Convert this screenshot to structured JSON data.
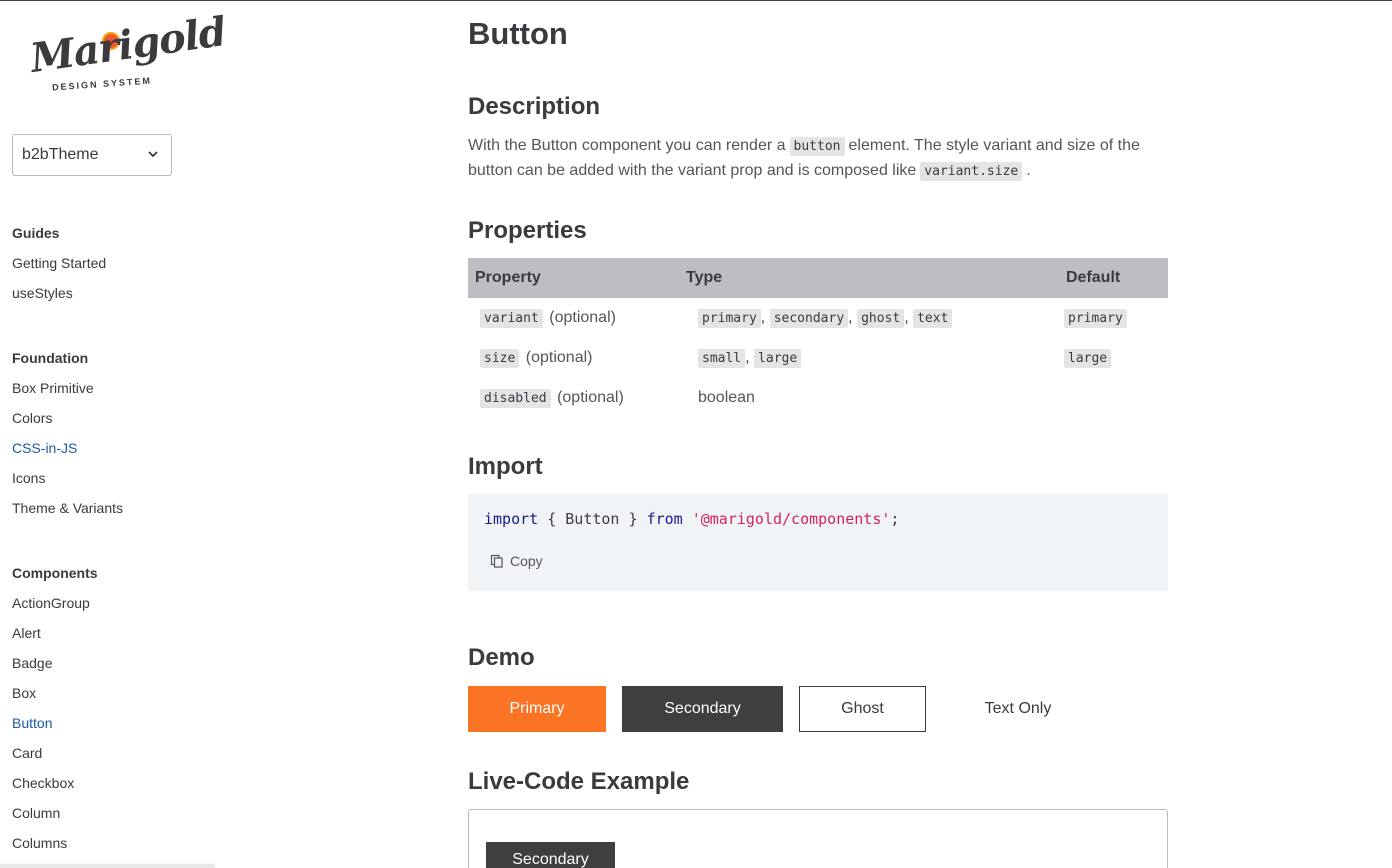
{
  "logo": {
    "script": "Marigold",
    "subtitle": "DESIGN SYSTEM"
  },
  "theme_select": {
    "value": "b2bTheme"
  },
  "sidebar": {
    "guides": {
      "title": "Guides",
      "items": [
        "Getting Started",
        "useStyles"
      ]
    },
    "foundation": {
      "title": "Foundation",
      "items": [
        "Box Primitive",
        "Colors",
        "CSS-in-JS",
        "Icons",
        "Theme & Variants"
      ]
    },
    "components": {
      "title": "Components",
      "items": [
        "ActionGroup",
        "Alert",
        "Badge",
        "Box",
        "Button",
        "Card",
        "Checkbox",
        "Column",
        "Columns"
      ]
    }
  },
  "page": {
    "title": "Button",
    "description_heading": "Description",
    "description": {
      "part1": "With the Button component you can render a",
      "code1": "button",
      "part2": "element. The style variant and size of the button can be added with the variant prop and is composed like",
      "code2": "variant.size",
      "part3": "."
    },
    "properties_heading": "Properties",
    "table": {
      "headers": [
        "Property",
        "Type",
        "Default"
      ],
      "rows": [
        {
          "property": "variant",
          "optional": "(optional)",
          "types": [
            "primary",
            "secondary",
            "ghost",
            "text"
          ],
          "default": "primary"
        },
        {
          "property": "size",
          "optional": "(optional)",
          "types": [
            "small",
            "large"
          ],
          "default": "large"
        },
        {
          "property": "disabled",
          "optional": "(optional)",
          "type_text": "boolean",
          "default": ""
        }
      ]
    },
    "import_heading": "Import",
    "import_code": {
      "kw_import": "import",
      "braces": " { Button } ",
      "kw_from": "from",
      "module": "'@marigold/components'",
      "semi": ";"
    },
    "copy_label": "Copy",
    "demo_heading": "Demo",
    "demo_buttons": {
      "primary": "Primary",
      "secondary": "Secondary",
      "ghost": "Ghost",
      "text": "Text Only"
    },
    "live_heading": "Live-Code Example",
    "live_button": "Secondary"
  },
  "colors": {
    "primary": "#fa7423",
    "secondary": "#3f3f40",
    "active_link": "#1c5aa0",
    "table_header": "#bdbdc3",
    "code_bg": "#f1f4f7"
  }
}
